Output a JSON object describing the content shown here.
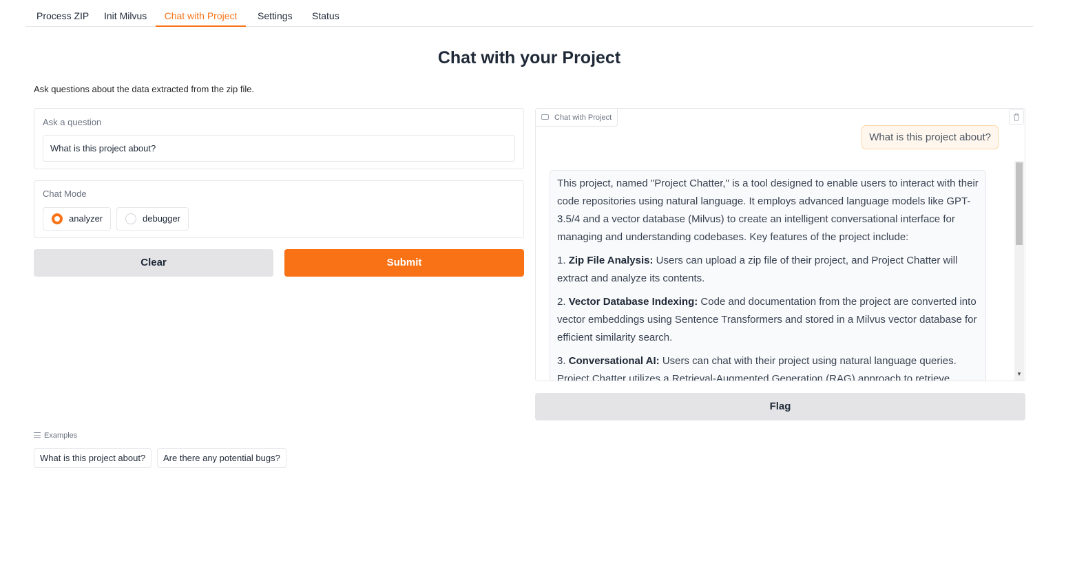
{
  "tabs": [
    "Process ZIP",
    "Init Milvus",
    "Chat with Project",
    "Settings",
    "Status"
  ],
  "active_tab": "Chat with Project",
  "accent_color": "#f97316",
  "title": "Chat with your Project",
  "description": "Ask questions about the data extracted from the zip file.",
  "question": {
    "label": "Ask a question",
    "value": "What is this project about?"
  },
  "chat_mode": {
    "label": "Chat Mode",
    "options": [
      "analyzer",
      "debugger"
    ],
    "selected": "analyzer"
  },
  "buttons": {
    "clear": "Clear",
    "submit": "Submit",
    "flag": "Flag"
  },
  "chatbot": {
    "label": "Chat with Project",
    "user_message": "What is this project about?",
    "bot_intro": "This project, named \"Project Chatter,\" is a tool designed to enable users to interact with their code repositories using natural language. It employs advanced language models like GPT-3.5/4 and a vector database (Milvus) to create an intelligent conversational interface for managing and understanding codebases. Key features of the project include:",
    "points": [
      {
        "num": "1.",
        "title": "Zip File Analysis:",
        "text": "Users can upload a zip file of their project, and Project Chatter will extract and analyze its contents."
      },
      {
        "num": "2.",
        "title": "Vector Database Indexing:",
        "text": "Code and documentation from the project are converted into vector embeddings using Sentence Transformers and stored in a Milvus vector database for efficient similarity search."
      },
      {
        "num": "3.",
        "title": "Conversational AI:",
        "text": "Users can chat with their project using natural language queries. Project Chatter utilizes a Retrieval-Augmented Generation (RAG) approach to retrieve"
      }
    ]
  },
  "examples": {
    "label": "Examples",
    "items": [
      "What is this project about?",
      "Are there any potential bugs?"
    ]
  }
}
